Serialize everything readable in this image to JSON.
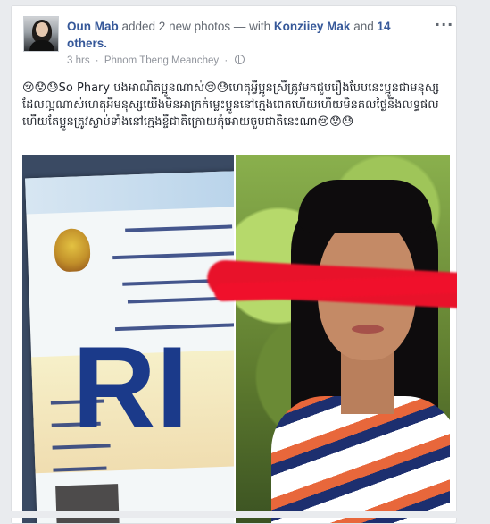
{
  "post": {
    "author": "Oun Mab",
    "action": "added 2 new photos",
    "with_prefix": "— with",
    "tagged": "Konziiey Mak",
    "and_text": "and",
    "others": "14 others.",
    "time": "3 hrs",
    "location": "Phnom Tbeng Meanchey",
    "privacy_icon": "globe-icon",
    "more_icon": "more-dots-icon",
    "text": "😢😟😓So Phary បងអាណិតប្អូនណាស់😢😓ហេតុអ្វីប្អូនស្រីត្រូវមកជួបរឿងបែបនេះប្អូនជាមនុស្សដែលល្អណាស់ហេតុអីមនុស្សយើងមិនអាក្រក់ម្លេះប្អូននៅក្មេងពេកហើយហើយមិនគលថ្ងៃនឹងលទ្ធផលហើយតែប្អូនត្រូវស្លាប់ទាំងនៅក្មេងខ្ចីជាតិក្រោយកុំអោយចួបជាតិនេះណា😢😟😓"
  },
  "photos": {
    "left_overlay_text": "RI"
  },
  "colors": {
    "link": "#365899",
    "muted": "#90949c",
    "redaction": "#e8122a"
  }
}
